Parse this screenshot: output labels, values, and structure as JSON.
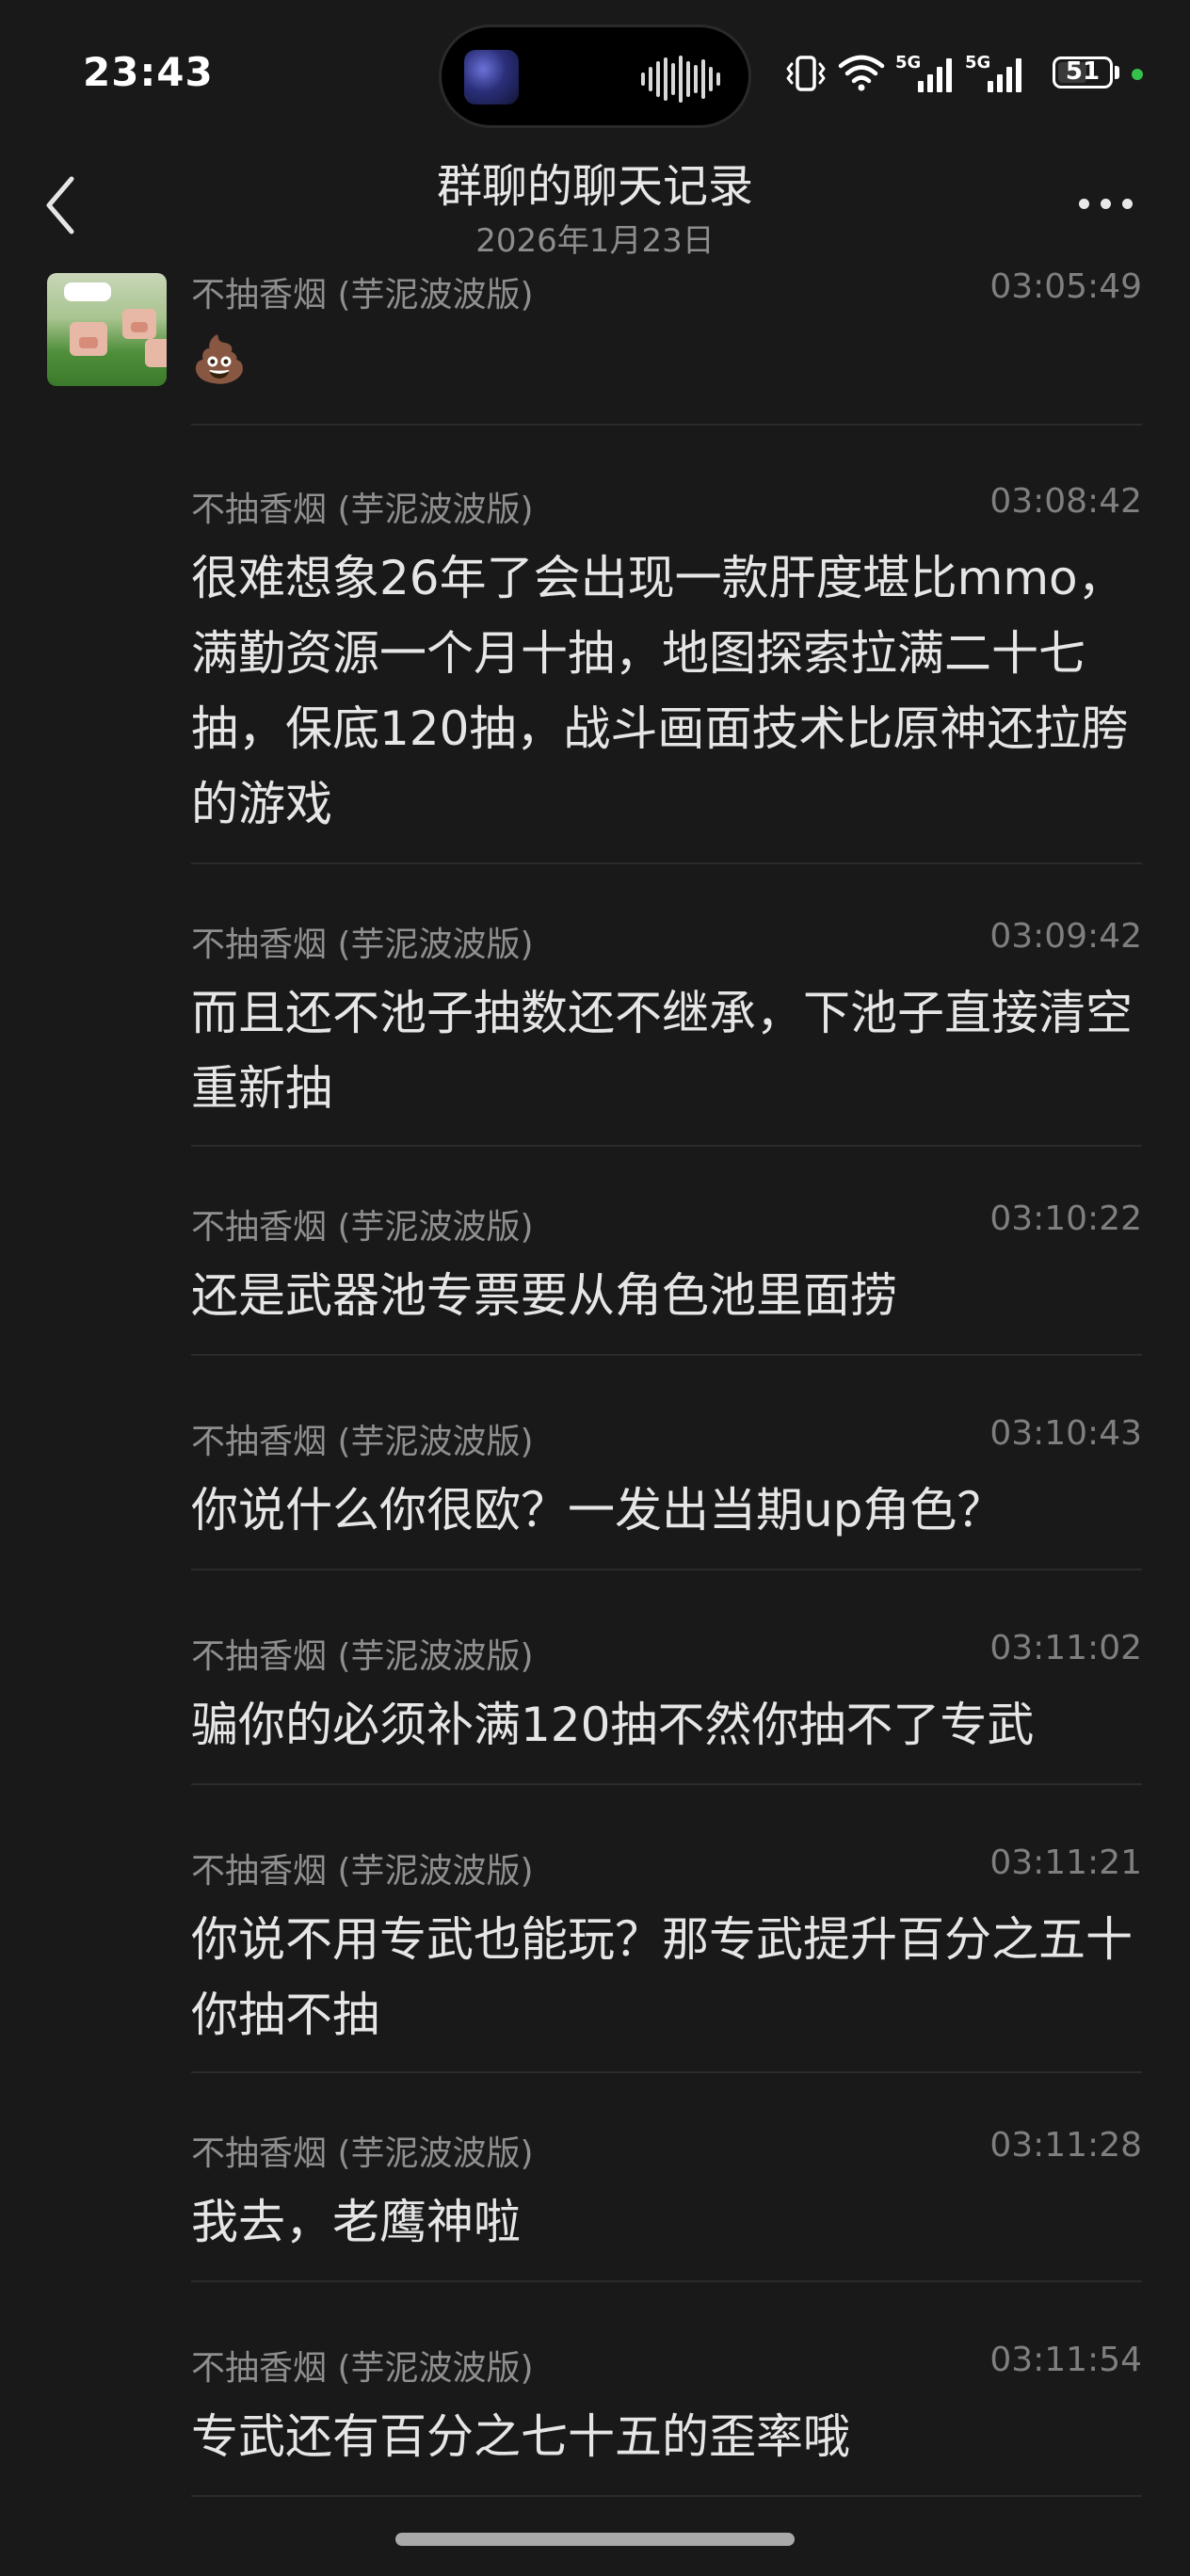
{
  "status_bar": {
    "time": "23:43",
    "battery_level": "51",
    "network_1": "5G",
    "network_2": "5G"
  },
  "header": {
    "title": "群聊的聊天记录",
    "date": "2026年1月23日"
  },
  "messages": [
    {
      "sender": "不抽香烟 (芋泥波波版)",
      "time": "03:05:49",
      "text": "💩"
    },
    {
      "sender": "不抽香烟 (芋泥波波版)",
      "time": "03:08:42",
      "text": "很难想象26年了会出现一款肝度堪比mmo，满勤资源一个月十抽，地图探索拉满二十七抽，保底120抽，战斗画面技术比原神还拉胯的游戏"
    },
    {
      "sender": "不抽香烟 (芋泥波波版)",
      "time": "03:09:42",
      "text": "而且还不池子抽数还不继承，下池子直接清空重新抽"
    },
    {
      "sender": "不抽香烟 (芋泥波波版)",
      "time": "03:10:22",
      "text": "还是武器池专票要从角色池里面捞"
    },
    {
      "sender": "不抽香烟 (芋泥波波版)",
      "time": "03:10:43",
      "text": "你说什么你很欧？一发出当期up角色？"
    },
    {
      "sender": "不抽香烟 (芋泥波波版)",
      "time": "03:11:02",
      "text": "骗你的必须补满120抽不然你抽不了专武"
    },
    {
      "sender": "不抽香烟 (芋泥波波版)",
      "time": "03:11:21",
      "text": "你说不用专武也能玩？那专武提升百分之五十你抽不抽"
    },
    {
      "sender": "不抽香烟 (芋泥波波版)",
      "time": "03:11:28",
      "text": "我去，老鹰神啦"
    },
    {
      "sender": "不抽香烟 (芋泥波波版)",
      "time": "03:11:54",
      "text": "专武还有百分之七十五的歪率哦"
    }
  ]
}
